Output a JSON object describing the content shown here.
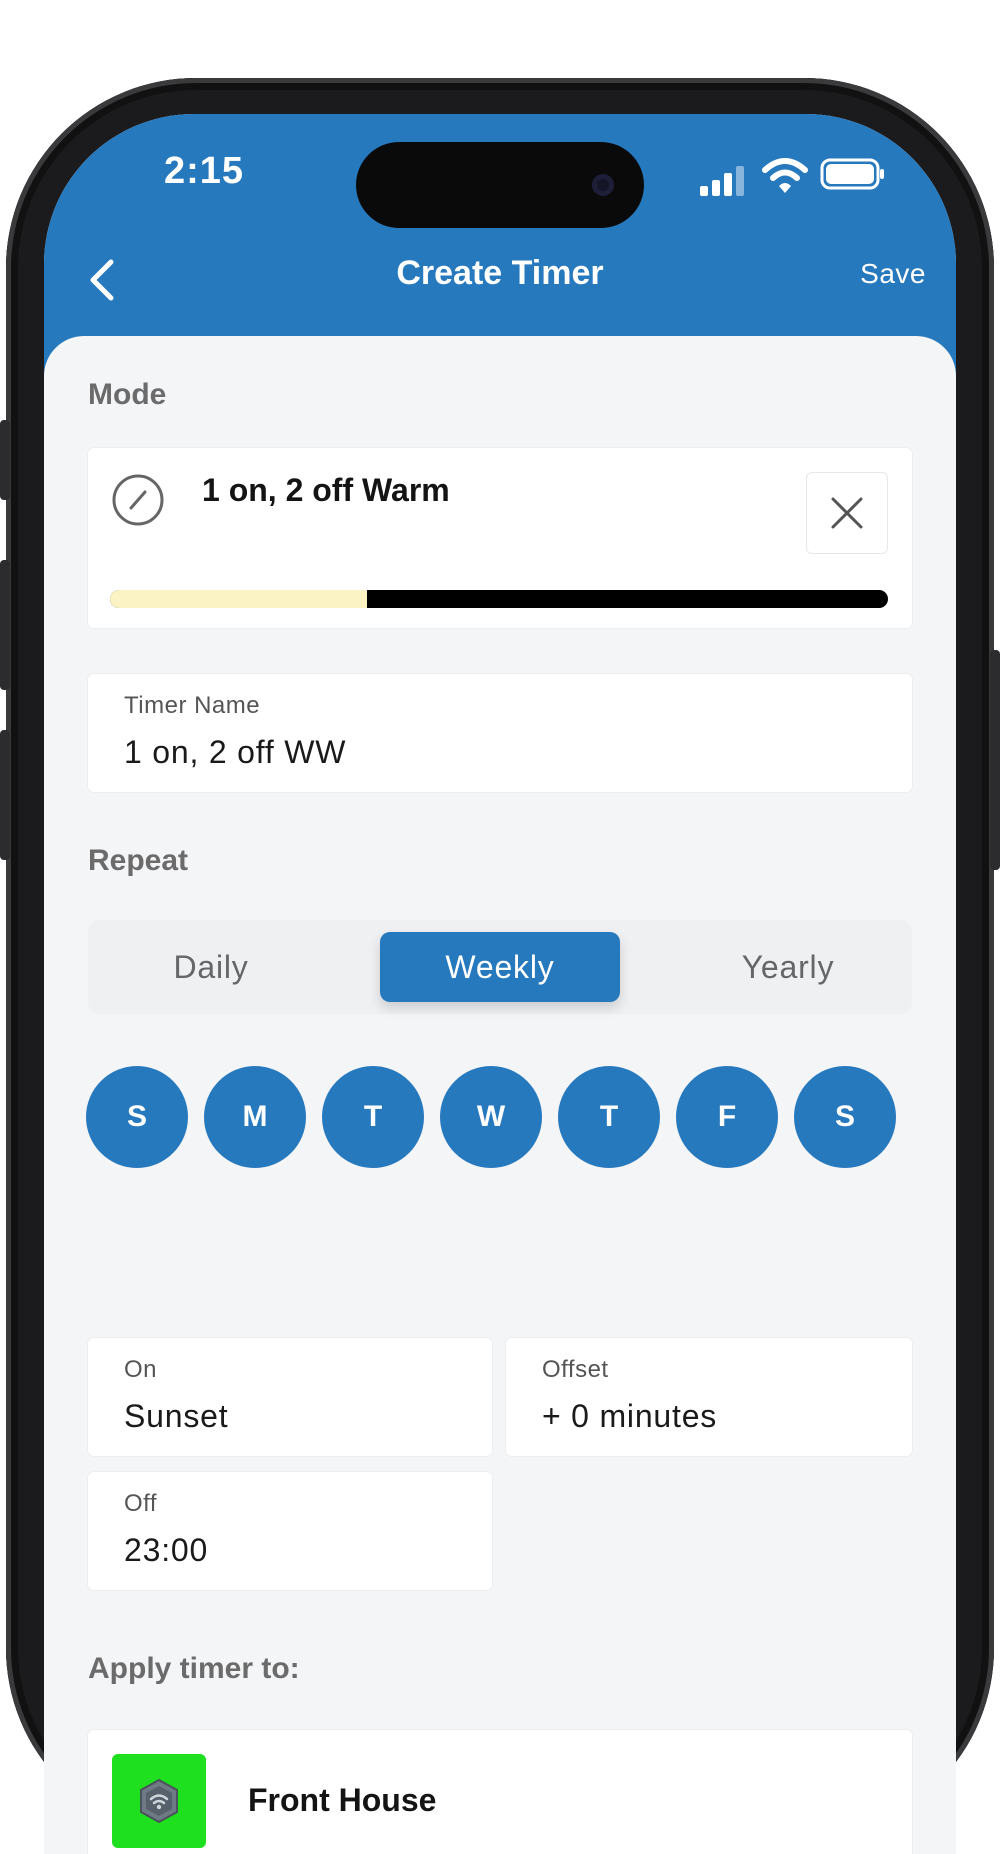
{
  "status_bar": {
    "time": "2:15",
    "icons": [
      "cellular-signal-icon",
      "wifi-icon",
      "battery-icon"
    ]
  },
  "header": {
    "back_icon": "chevron-left-icon",
    "title": "Create Timer",
    "save_label": "Save"
  },
  "mode": {
    "section_title": "Mode",
    "icon": "slashed-circle-icon",
    "name": "1 on, 2 off Warm",
    "clear_icon": "close-icon",
    "warm_fraction": 0.33,
    "colors": {
      "warm": "#fbf3c4",
      "off": "#000000"
    }
  },
  "timer_name": {
    "label": "Timer Name",
    "value": "1 on, 2 off WW"
  },
  "repeat": {
    "section_title": "Repeat",
    "options": [
      "Daily",
      "Weekly",
      "Yearly"
    ],
    "selected": "Weekly",
    "days": [
      "S",
      "M",
      "T",
      "W",
      "T",
      "F",
      "S"
    ]
  },
  "schedule": {
    "on": {
      "label": "On",
      "value": "Sunset"
    },
    "offset": {
      "label": "Offset",
      "value": "+ 0 minutes"
    },
    "off": {
      "label": "Off",
      "value": "23:00"
    }
  },
  "apply": {
    "section_title": "Apply timer to:",
    "device_icon": "hub-wifi-icon",
    "device_name": "Front House"
  },
  "colors": {
    "primary": "#2779be",
    "background": "#f4f5f7",
    "device_green": "#1ee01e"
  }
}
